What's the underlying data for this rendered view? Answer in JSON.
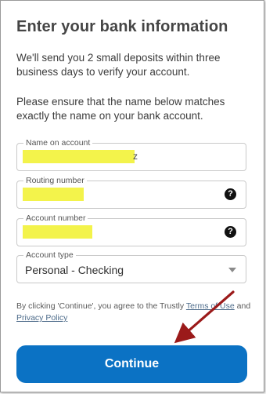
{
  "header": {
    "title": "Enter your bank information"
  },
  "intro": {
    "deposit_text": "We'll send you 2 small deposits within three business days to verify your account.",
    "name_match_text": "Please ensure that the name below matches exactly the name on your bank account."
  },
  "form": {
    "name_on_account": {
      "label": "Name on account",
      "visible_suffix": "z"
    },
    "routing_number": {
      "label": "Routing number",
      "help_glyph": "?"
    },
    "account_number": {
      "label": "Account number",
      "help_glyph": "?"
    },
    "account_type": {
      "label": "Account type",
      "value": "Personal - Checking"
    }
  },
  "terms": {
    "prefix": "By clicking 'Continue', you agree to the Trustly ",
    "terms_link": "Terms of Use",
    "conjunction": " and ",
    "privacy_link": "Privacy Policy"
  },
  "continue_button": {
    "label": "Continue"
  },
  "colors": {
    "accent": "#0b72c4",
    "redaction_highlight": "#f2f23c",
    "annotation_arrow": "#9b1a1a"
  },
  "icons": {
    "help": "question-circle-icon",
    "dropdown": "caret-down-icon",
    "annotation": "arrow-annotation"
  }
}
